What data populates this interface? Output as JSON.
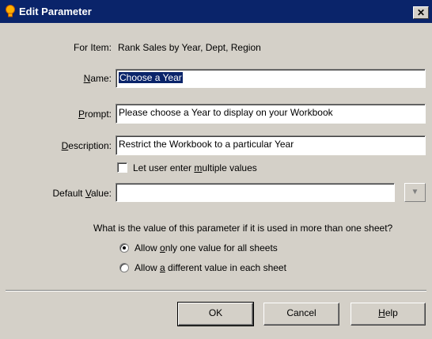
{
  "window": {
    "title": "Edit Parameter",
    "close_glyph": "✕"
  },
  "form": {
    "for_item_label": "For Item:",
    "for_item_value": "Rank Sales by Year, Dept, Region",
    "name_label_pre": "",
    "name_label_ul": "N",
    "name_label_post": "ame:",
    "name_value": "Choose a Year",
    "prompt_label_ul": "P",
    "prompt_label_post": "rompt:",
    "prompt_value": "Please choose a Year to display on your Workbook",
    "description_label_ul": "D",
    "description_label_post": "escription:",
    "description_value": "Restrict the Workbook to a particular Year",
    "multi_pre": "Let user enter ",
    "multi_ul": "m",
    "multi_post": "ultiple values",
    "multi_checked": false,
    "default_label_pre": "Default ",
    "default_label_ul": "V",
    "default_label_post": "alue:",
    "default_value": "",
    "question": "What is the value of this parameter if it is used in more than one sheet?",
    "option1_pre": "Allow ",
    "option1_ul": "o",
    "option1_post": "nly one value for all sheets",
    "option1_selected": true,
    "option2_pre": "Allow ",
    "option2_ul": "a",
    "option2_post": " different value in each sheet",
    "option2_selected": false
  },
  "buttons": {
    "ok": "OK",
    "cancel": "Cancel",
    "help_ul": "H",
    "help_post": "elp"
  },
  "icons": {
    "title": "bulb-icon",
    "dropdown": "chevron-down-icon",
    "close": "close-icon"
  },
  "colors": {
    "titlebar": "#0a246a",
    "face": "#d4d0c8",
    "selection": "#0a246a"
  }
}
